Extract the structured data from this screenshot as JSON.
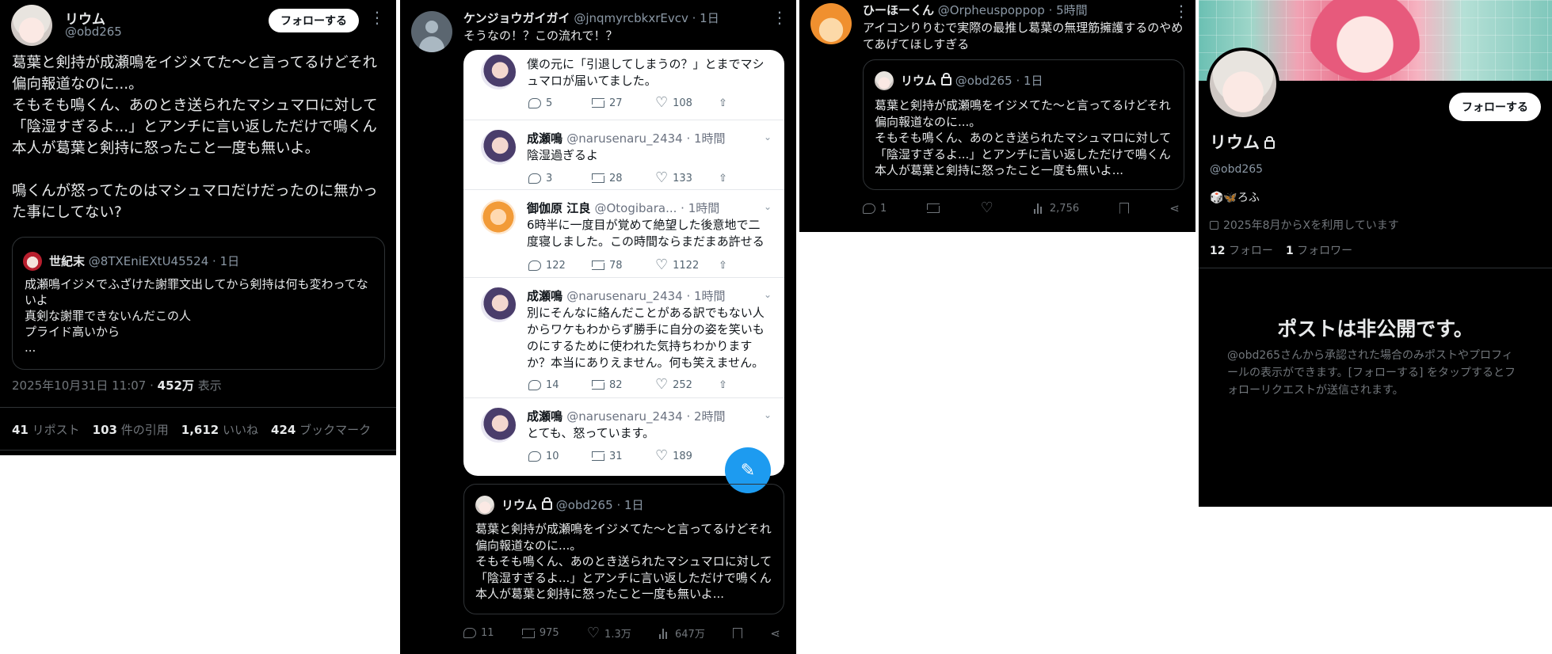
{
  "panel1": {
    "name": "リウム",
    "handle": "@obd265",
    "follow_label": "フォローする",
    "body": "葛葉と剣持が成瀬鳴をイジメてた〜と言ってるけどそれ偏向報道なのに...。\nそもそも鳴くん、あのとき送られたマシュマロに対して「陰湿すぎるよ...」とアンチに言い返しただけで鳴くん本人が葛葉と剣持に怒ったこと一度も無いよ。\n\n鳴くんが怒ってたのはマシュマロだけだったのに無かった事にしてない?",
    "quote": {
      "name": "世紀末",
      "handle": "@8TXEniEXtU45524",
      "time": "· 1日",
      "text": "成瀬鳴イジメでふざけた謝罪文出してから剣持は何も変わってないよ\n真剣な謝罪できないんだこの人\nプライド高いから\n..."
    },
    "timestamp": "2025年10月31日 11:07 ·",
    "views_n": "452万",
    "views_l": "表示",
    "stats": [
      {
        "n": "41",
        "l": "リポスト"
      },
      {
        "n": "103",
        "l": "件の引用"
      },
      {
        "n": "1,612",
        "l": "いいね"
      },
      {
        "n": "424",
        "l": "ブックマーク"
      }
    ]
  },
  "panel2": {
    "name": "ケンジョウガイガイ",
    "handle": "@jnqmyrcbkxrEvcv",
    "time": "· 1日",
    "body": "そうなの！？この流れで！？",
    "inner": [
      {
        "name": "成瀬鳴",
        "handle": "@narusenaru_2434 · 1時間",
        "text": "僕の元に「引退してしまうの？」とまでマシュマロが届いてました。",
        "reply": "5",
        "rt": "27",
        "like": "108"
      },
      {
        "name": "成瀬鳴",
        "handle": "@narusenaru_2434 · 1時間",
        "text": "陰湿過ぎるよ",
        "reply": "3",
        "rt": "28",
        "like": "133"
      },
      {
        "name": "御伽原 江良",
        "handle": "@Otogibara... · 1時間",
        "text": "6時半に一度目が覚めて絶望した後意地で二度寝しました。この時間ならまだまあ許せる",
        "reply": "122",
        "rt": "78",
        "like": "1122"
      },
      {
        "name": "成瀬鳴",
        "handle": "@narusenaru_2434 · 1時間",
        "text": "別にそんなに絡んだことがある訳でもない人からワケもわからず勝手に自分の姿を笑いものにするために使われた気持ちわかりますか？本当にありえません。何も笑えません。",
        "reply": "14",
        "rt": "82",
        "like": "252"
      },
      {
        "name": "成瀬鳴",
        "handle": "@narusenaru_2434 · 2時間",
        "text": "とても、怒っています。",
        "reply": "10",
        "rt": "31",
        "like": "189"
      }
    ],
    "quote": {
      "name": "リウム",
      "handle": "@obd265",
      "time": "· 1日",
      "text": "葛葉と剣持が成瀬鳴をイジメてた〜と言ってるけどそれ偏向報道なのに...。\nそもそも鳴くん、あのとき送られたマシュマロに対して「陰湿すぎるよ...」とアンチに言い返しただけで鳴くん本人が葛葉と剣持に怒ったこと一度も無いよ..."
    },
    "actions": {
      "reply": "11",
      "rt": "975",
      "like": "1.3万",
      "views": "647万"
    }
  },
  "panel3": {
    "name": "ひーほーくん",
    "handle": "@Orpheuspoppop",
    "time": "· 5時間",
    "body": "アイコンりりむで実際の最推し葛葉の無理筋擁護するのやめてあげてほしすぎる",
    "quote": {
      "name": "リウム",
      "handle": "@obd265",
      "time": "· 1日",
      "text": "葛葉と剣持が成瀬鳴をイジメてた〜と言ってるけどそれ偏向報道なのに...。\nそもそも鳴くん、あのとき送られたマシュマロに対して「陰湿すぎるよ...」とアンチに言い返しただけで鳴くん本人が葛葉と剣持に怒ったこと一度も無いよ..."
    },
    "actions": {
      "reply": "1",
      "views": "2,756"
    }
  },
  "panel4": {
    "follow_label": "フォローする",
    "name": "リウム",
    "handle": "@obd265",
    "bio": "🎲🦋ろふ",
    "joined": "2025年8月からXを利用しています",
    "following_n": "12",
    "following_l": "フォロー",
    "followers_n": "1",
    "followers_l": "フォロワー",
    "private_title": "ポストは非公開です。",
    "private_text": "@obd265さんから承認された場合のみポストやプロフィールの表示ができます。[フォローする] をタップするとフォローリクエストが送信されます。"
  },
  "colors": {
    "accent": "#1d9bf0",
    "muted": "#71767b",
    "bg": "#000000"
  }
}
